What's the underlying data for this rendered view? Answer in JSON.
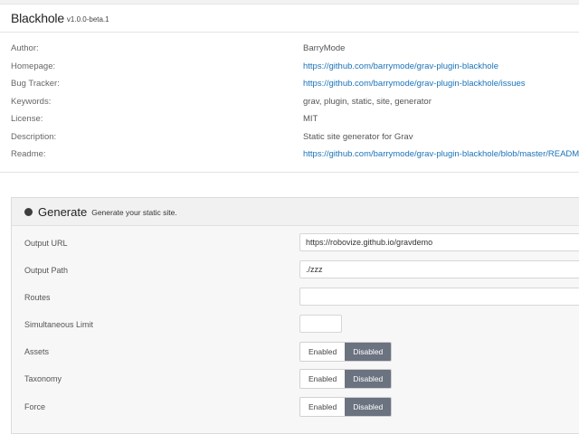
{
  "plugin": {
    "name": "Blackhole",
    "version": "v1.0.0-beta.1"
  },
  "info": [
    {
      "label": "Author:",
      "value": "BarryMode",
      "link": false
    },
    {
      "label": "Homepage:",
      "value": "https://github.com/barrymode/grav-plugin-blackhole",
      "link": true
    },
    {
      "label": "Bug Tracker:",
      "value": "https://github.com/barrymode/grav-plugin-blackhole/issues",
      "link": true
    },
    {
      "label": "Keywords:",
      "value": "grav, plugin, static, site, generator",
      "link": false
    },
    {
      "label": "License:",
      "value": "MIT",
      "link": false
    },
    {
      "label": "Description:",
      "value": "Static site generator for Grav",
      "link": false
    },
    {
      "label": "Readme:",
      "value": "https://github.com/barrymode/grav-plugin-blackhole/blob/master/README.md",
      "link": true
    }
  ],
  "generate": {
    "title": "Generate",
    "subtitle": "Generate your static site.",
    "output_url": {
      "label": "Output URL",
      "value": "https://robovize.github.io/gravdemo"
    },
    "output_path": {
      "label": "Output Path",
      "value": "./zzz"
    },
    "routes": {
      "label": "Routes",
      "value": ""
    },
    "simultaneous_limit": {
      "label": "Simultaneous Limit",
      "value": ""
    },
    "assets": {
      "label": "Assets",
      "enabled_label": "Enabled",
      "disabled_label": "Disabled",
      "selected": "Disabled"
    },
    "taxonomy": {
      "label": "Taxonomy",
      "enabled_label": "Enabled",
      "disabled_label": "Disabled",
      "selected": "Disabled"
    },
    "force": {
      "label": "Force",
      "enabled_label": "Enabled",
      "disabled_label": "Disabled",
      "selected": "Disabled"
    }
  },
  "colors": {
    "link": "#1a73b8",
    "toggle_active": "#6b7280"
  }
}
